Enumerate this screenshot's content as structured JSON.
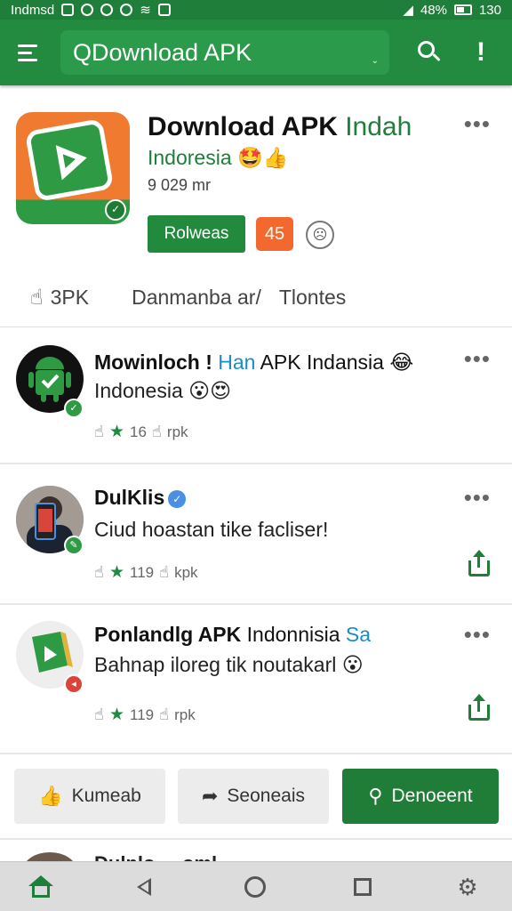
{
  "status_bar": {
    "carrier": "Indmsd",
    "battery": "48%",
    "time": "130"
  },
  "app_bar": {
    "search_text": "QDownload APK",
    "search_caret": "⌄",
    "alert_label": "!"
  },
  "header": {
    "title_main": "Download APK ",
    "title_accent": "Indah",
    "subtitle": "Indoresia 🤩👍",
    "meta": "9 029 mr",
    "install_label": "Rolweas",
    "rating": "45",
    "more": "•••",
    "tabs": [
      {
        "label": "3PK"
      },
      {
        "label": "Danmanba ar/"
      },
      {
        "label": "Tlontes"
      }
    ]
  },
  "posts": [
    {
      "title_bold": "Mowinloch ! ",
      "title_blue": "Han",
      "title_rest": " APK Indansia 😂",
      "body": "Indonesia 😮😍",
      "likes": "16",
      "shares": "rpk",
      "more": "•••"
    },
    {
      "title_bold": "DulKlis",
      "verified": "✓",
      "body": "Ciud hoastan tike facliser!",
      "likes": "119",
      "shares": "kpk",
      "more": "•••"
    },
    {
      "title_bold": "Ponlandlg APK",
      "title_rest": " Indonnisia ",
      "title_blue": "Sa",
      "body": "Bahnap iloreg tik noutakarl 😮",
      "likes": "119",
      "shares": "rpk",
      "more": "•••"
    }
  ],
  "actions": {
    "like_label": "Kumeab",
    "share_label": "Seoneais",
    "download_label": "Denoeent"
  },
  "peek": {
    "text": "Dulnlo ... oml..."
  },
  "colors": {
    "primary": "#228b3f",
    "primary_dark": "#1e7e3a",
    "accent_orange": "#f2682e",
    "accent_blue": "#1b8cc8"
  },
  "icons": [
    "menu-icon",
    "search-icon",
    "alert-icon",
    "more-icon",
    "thumb-up-icon",
    "star-icon",
    "share-icon",
    "download-icon",
    "home-icon",
    "back-icon",
    "circle-icon",
    "square-icon",
    "gear-icon"
  ]
}
